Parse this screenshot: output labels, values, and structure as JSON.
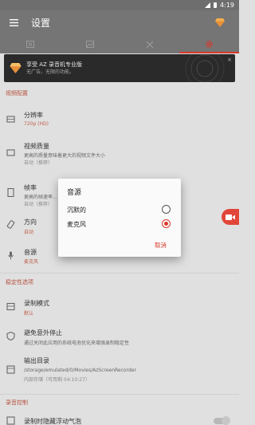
{
  "status_bar": {
    "time": "4:19"
  },
  "app_bar": {
    "title": "设置"
  },
  "tabs": [
    {
      "icon": "video-icon",
      "active": false
    },
    {
      "icon": "image-icon",
      "active": false
    },
    {
      "icon": "tools-icon",
      "active": false
    },
    {
      "icon": "gear-icon",
      "active": true
    }
  ],
  "banner": {
    "title": "享受 AZ 录音机专业版",
    "subtitle": "无广告。无限的功能。",
    "close": "×"
  },
  "sections": {
    "video": "视频配置",
    "stability": "稳定性选项",
    "recording_control": "录音控制"
  },
  "settings": {
    "resolution": {
      "title": "分辨率",
      "value": "720p (HD)"
    },
    "quality": {
      "title": "视频质量",
      "desc": "更高的质量意味着更大的视频文件大小",
      "value": "自动（推荐）"
    },
    "framerate": {
      "title": "帧率",
      "desc": "更高的帧速率...",
      "value": "自动（推荐）"
    },
    "orientation": {
      "title": "方向",
      "value": "自动"
    },
    "audio_source": {
      "title": "音源",
      "value": "麦克风"
    },
    "record_mode": {
      "title": "录制模式",
      "value": "默认"
    },
    "avoid_stop": {
      "title": "避免意外停止",
      "desc": "通过关闭此应用的系统电池优化来增强录制稳定性"
    },
    "output_dir": {
      "title": "输出目录",
      "desc": "/storage/emulated/0/Movies/AzScreenRecorder",
      "value": "内部存储（可用剩 04:10:27）"
    },
    "hide_bubble": {
      "title": "录制时隐藏浮动气泡"
    }
  },
  "dialog": {
    "title": "音源",
    "options": [
      {
        "label": "沉默的",
        "checked": false
      },
      {
        "label": "麦克风",
        "checked": true
      }
    ],
    "cancel": "取消"
  },
  "colors": {
    "accent": "#d9382b",
    "app_bar": "#757575",
    "section": "#b6523e"
  }
}
